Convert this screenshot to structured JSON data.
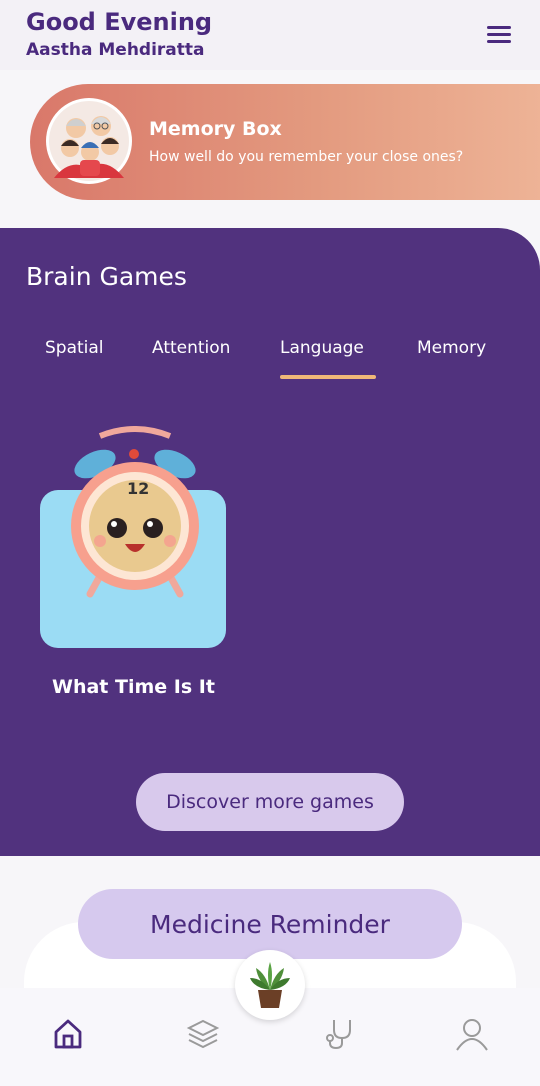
{
  "header": {
    "greeting": "Good Evening",
    "user_name": "Aastha Mehdiratta",
    "menu_icon": "hamburger-menu-icon"
  },
  "memory_box": {
    "title": "Memory Box",
    "subtitle": "How well do you remember your close ones?"
  },
  "brain_games": {
    "title": "Brain Games",
    "tabs": [
      {
        "label": "Spatial"
      },
      {
        "label": "Attention"
      },
      {
        "label": "Language",
        "active": true
      },
      {
        "label": "Memory"
      }
    ],
    "games": [
      {
        "label": "What Time Is It",
        "icon": "alarm-clock-icon"
      }
    ],
    "discover_label": "Discover more games"
  },
  "medicine": {
    "label": "Medicine Reminder"
  },
  "bottom_nav": {
    "items": [
      "home-icon",
      "layers-icon",
      "plant-icon",
      "stethoscope-icon",
      "profile-icon"
    ],
    "active": "home-icon"
  },
  "colors": {
    "primary": "#51327e",
    "accent": "#f0b878",
    "memory_gradient_start": "#d9786a",
    "memory_gradient_end": "#eeb497"
  }
}
